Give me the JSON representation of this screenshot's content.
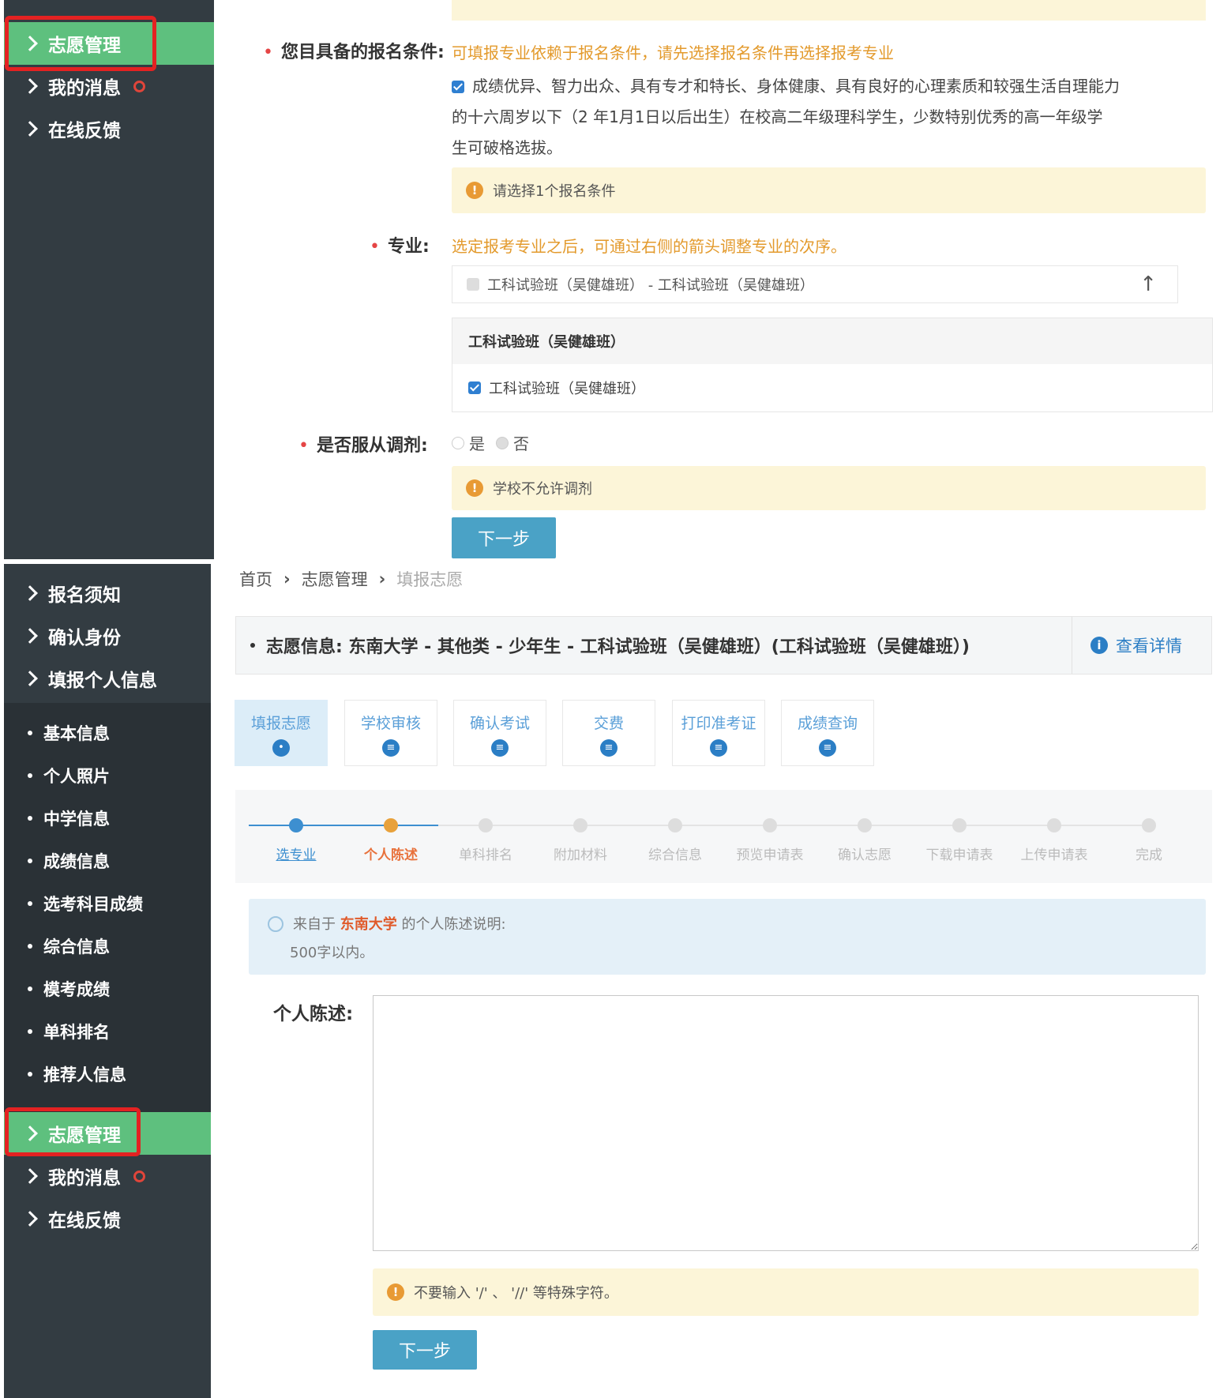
{
  "sidebar_top": {
    "items": [
      {
        "label": "志愿管理",
        "active": true
      },
      {
        "label": "我的消息",
        "badge": true
      },
      {
        "label": "在线反馈"
      }
    ]
  },
  "form_top": {
    "conditions_label": "您目具备的报名条件:",
    "conditions_note": "可填报专业依赖于报名条件，请先选择报名条件再选择报考专业",
    "condition_line1": "成绩优异、智力出众、具有专才和特长、身体健康、具有良好的心理素质和较强生活自理能力",
    "condition_line2": "的十六周岁以下（2      年1月1日以后出生）在校高二年级理科学生，少数特别优秀的高一年级学",
    "condition_line3": "生可破格选拔。",
    "condition_warning": "请选择1个报名条件",
    "major_label": "专业:",
    "major_note": "选定报考专业之后，可通过右侧的箭头调整专业的次序。",
    "major_selected": "工科试验班（吴健雄班） - 工科试验班（吴健雄班）",
    "major_group_title": "工科试验班（吴健雄班）",
    "major_option": "工科试验班（吴健雄班）",
    "adjust_label": "是否服从调剂:",
    "adjust_yes": "是",
    "adjust_no": "否",
    "adjust_warning": "学校不允许调剂",
    "next_button": "下一步"
  },
  "sidebar_bottom": {
    "items": [
      {
        "label": "报名须知"
      },
      {
        "label": "确认身份"
      },
      {
        "label": "填报个人信息"
      }
    ],
    "sub_items": [
      "基本信息",
      "个人照片",
      "中学信息",
      "成绩信息",
      "选考科目成绩",
      "综合信息",
      "模考成绩",
      "单科排名",
      "推荐人信息"
    ],
    "items_after": [
      {
        "label": "志愿管理",
        "active": true
      },
      {
        "label": "我的消息",
        "badge": true
      },
      {
        "label": "在线反馈"
      }
    ]
  },
  "breadcrumb": {
    "home": "首页",
    "section": "志愿管理",
    "current": "填报志愿"
  },
  "volunteer_info": {
    "text": "志愿信息:  东南大学 - 其他类 - 少年生 - 工科试验班（吴健雄班）(工科试验班（吴健雄班）)",
    "detail_link": "查看详情"
  },
  "tabs": [
    {
      "label": "填报志愿",
      "active": true
    },
    {
      "label": "学校审核"
    },
    {
      "label": "确认考试"
    },
    {
      "label": "交费"
    },
    {
      "label": "打印准考证"
    },
    {
      "label": "成绩查询"
    }
  ],
  "steps": [
    "选专业",
    "个人陈述",
    "单科排名",
    "附加材料",
    "综合信息",
    "预览申请表",
    "确认志愿",
    "下载申请表",
    "上传申请表",
    "完成"
  ],
  "steps_state": {
    "done": 1,
    "current": 2
  },
  "colors": {
    "accent": "#4aa2c6",
    "active_green": "#5ec07e",
    "warn": "#e39a2c",
    "current_step": "#e8a13b",
    "done_step": "#3d8fd0"
  },
  "statement": {
    "info_prefix": "来自于",
    "info_school": "东南大学",
    "info_suffix": "的个人陈述说明:",
    "info_limit": "500字以内。",
    "label": "个人陈述:",
    "warning": "不要输入 '/' 、 '//' 等特殊字符。",
    "next_button": "下一步"
  }
}
